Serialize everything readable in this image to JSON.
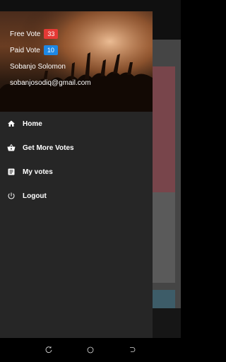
{
  "drawer": {
    "free_vote_label": "Free Vote",
    "free_vote_count": "33",
    "paid_vote_label": "Paid Vote",
    "paid_vote_count": "10",
    "user_name": "Sobanjo Solomon",
    "user_email": "sobanjosodiq@gmail.com"
  },
  "menu": {
    "home": "Home",
    "get_more_votes": "Get More Votes",
    "my_votes": "My votes",
    "logout": "Logout"
  },
  "icons": {
    "home": "home-icon",
    "get_more_votes": "basket-icon",
    "my_votes": "list-icon",
    "logout": "power-icon",
    "nav_back": "back-icon",
    "nav_home": "circle-home-icon",
    "nav_recents": "recents-icon"
  },
  "colors": {
    "drawer_bg": "#262626",
    "free_badge": "#e53935",
    "paid_badge": "#1e88e5"
  }
}
